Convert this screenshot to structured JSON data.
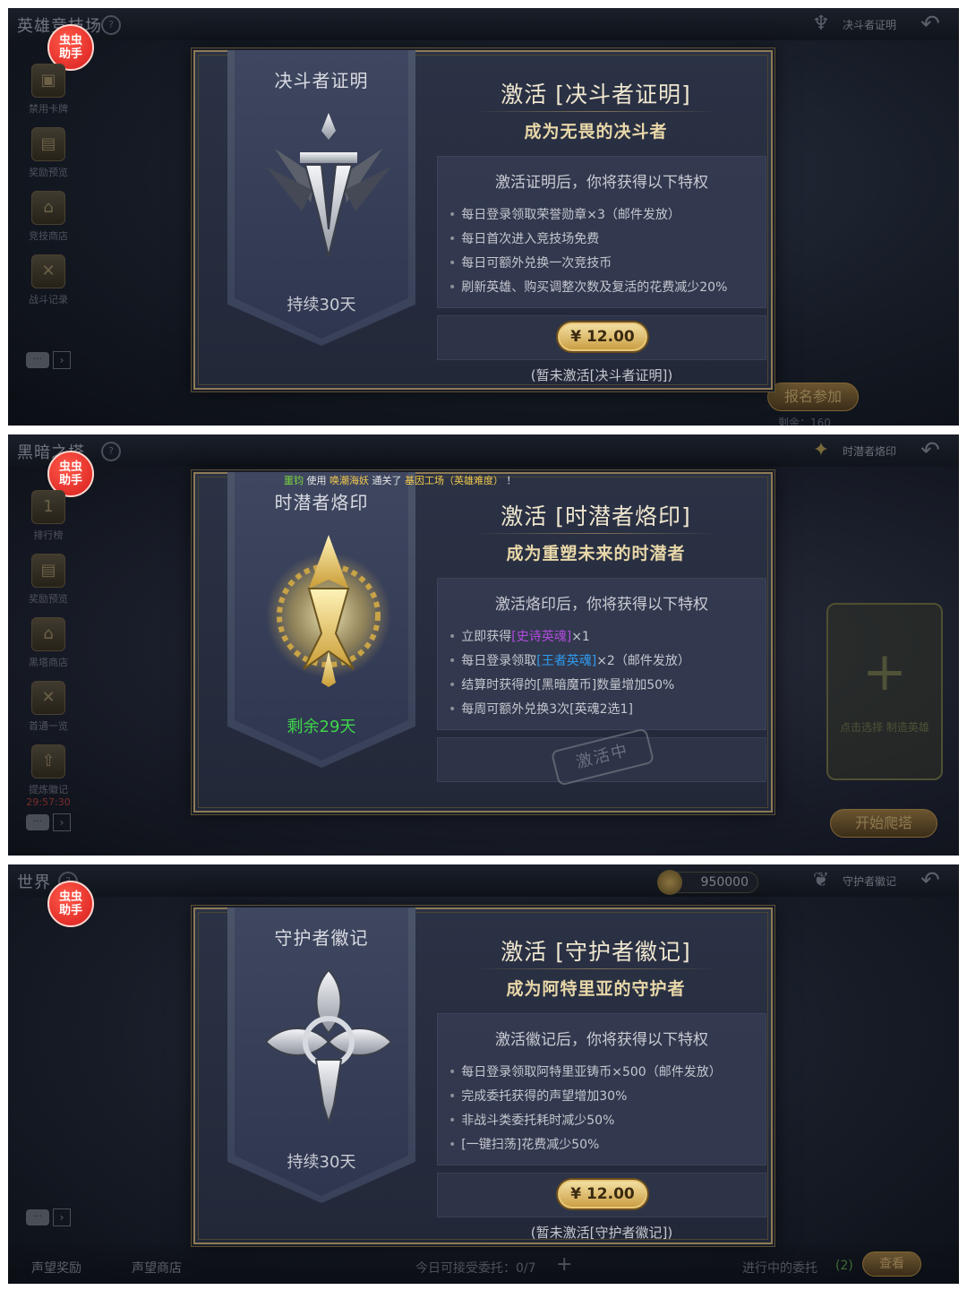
{
  "panels": [
    {
      "scene_title": "英雄竞技场",
      "top_right_label": "决斗者证明",
      "badge": "虫虫\n助手",
      "sidebar": [
        "禁用卡牌",
        "奖励预览",
        "竞技商店",
        "战斗记录"
      ],
      "ticker_fragment": ")！",
      "banner_title": "决斗者证明",
      "banner_days": "持续30天",
      "main_title": "激活 [决斗者证明]",
      "subtitle": "成为无畏的决斗者",
      "perk_header": "激活证明后，你将获得以下特权",
      "perks": [
        "每日登录领取荣誉勋章×3（邮件发放）",
        "每日首次进入竞技场免费",
        "每日可额外兑换一次竞技币",
        "刷新英雄、购买调整次数及复活的花费减少20%"
      ],
      "price": "¥ 12.00",
      "status": "(暂未激活[决斗者证明])",
      "bg_button": "报名参加",
      "bg_text": "剩余：160"
    },
    {
      "scene_title": "黑暗之塔",
      "top_right_label": "时潜者烙印",
      "badge": "虫虫\n助手",
      "sidebar": [
        "排行榜",
        "奖励预览",
        "黑塔商店",
        "首通一览",
        "提炼徽记"
      ],
      "sidebar_timer": "29:57:30",
      "ticker": {
        "name": "噩钧",
        "t1": " 使用 ",
        "hero": "唤潮海妖",
        "t2": " 通关了 ",
        "stage": "基因工场（英雄难度）",
        "t3": " ！"
      },
      "banner_title": "时潜者烙印",
      "banner_days": "剩余29天",
      "main_title": "激活 [时潜者烙印]",
      "subtitle": "成为重塑未来的时潜者",
      "perk_header": "激活烙印后，你将获得以下特权",
      "perks": [
        {
          "a": "立即获得",
          "b": "[史诗英魂]",
          "c": "×1"
        },
        {
          "a": "每日登录领取",
          "b": "[王者英魂]",
          "c": "×2（邮件发放）"
        },
        {
          "a": "结算时获得的[黑暗魔币]数量增加50%",
          "b": "",
          "c": ""
        },
        {
          "a": "每周可额外兑换3次[英魂2选1]",
          "b": "",
          "c": ""
        }
      ],
      "active_stamp": "激活中",
      "slot_hint": "点击选择\n制造英雄",
      "bg_button": "开始爬塔"
    },
    {
      "scene_title": "世界",
      "top_right_label": "守护者徽记",
      "badge": "虫虫\n助手",
      "coins": "950000",
      "banner_title": "守护者徽记",
      "banner_days": "持续30天",
      "main_title": "激活 [守护者徽记]",
      "subtitle": "成为阿特里亚的守护者",
      "perk_header": "激活徽记后，你将获得以下特权",
      "perks": [
        "每日登录领取阿特里亚铸币×500（邮件发放）",
        "完成委托获得的声望增加30%",
        "非战斗类委托耗时减少50%",
        "[一键扫荡]花费减少50%"
      ],
      "price": "¥ 12.00",
      "status": "(暂未激活[守护者徽记])",
      "bottom": {
        "rep_reward": "声望奖励",
        "rep_shop": "声望商店",
        "daily": "今日可接受委托：0/7",
        "ongoing": "进行中的委托",
        "ongoing_count": "(2)",
        "view": "查看"
      }
    }
  ],
  "colors": {
    "gold_border": "#8d7a55",
    "epic_purple": "#b24ae0",
    "king_blue": "#2f9bf0",
    "remaining_green": "#3fd64a",
    "badge_red": "#d81d1d"
  }
}
